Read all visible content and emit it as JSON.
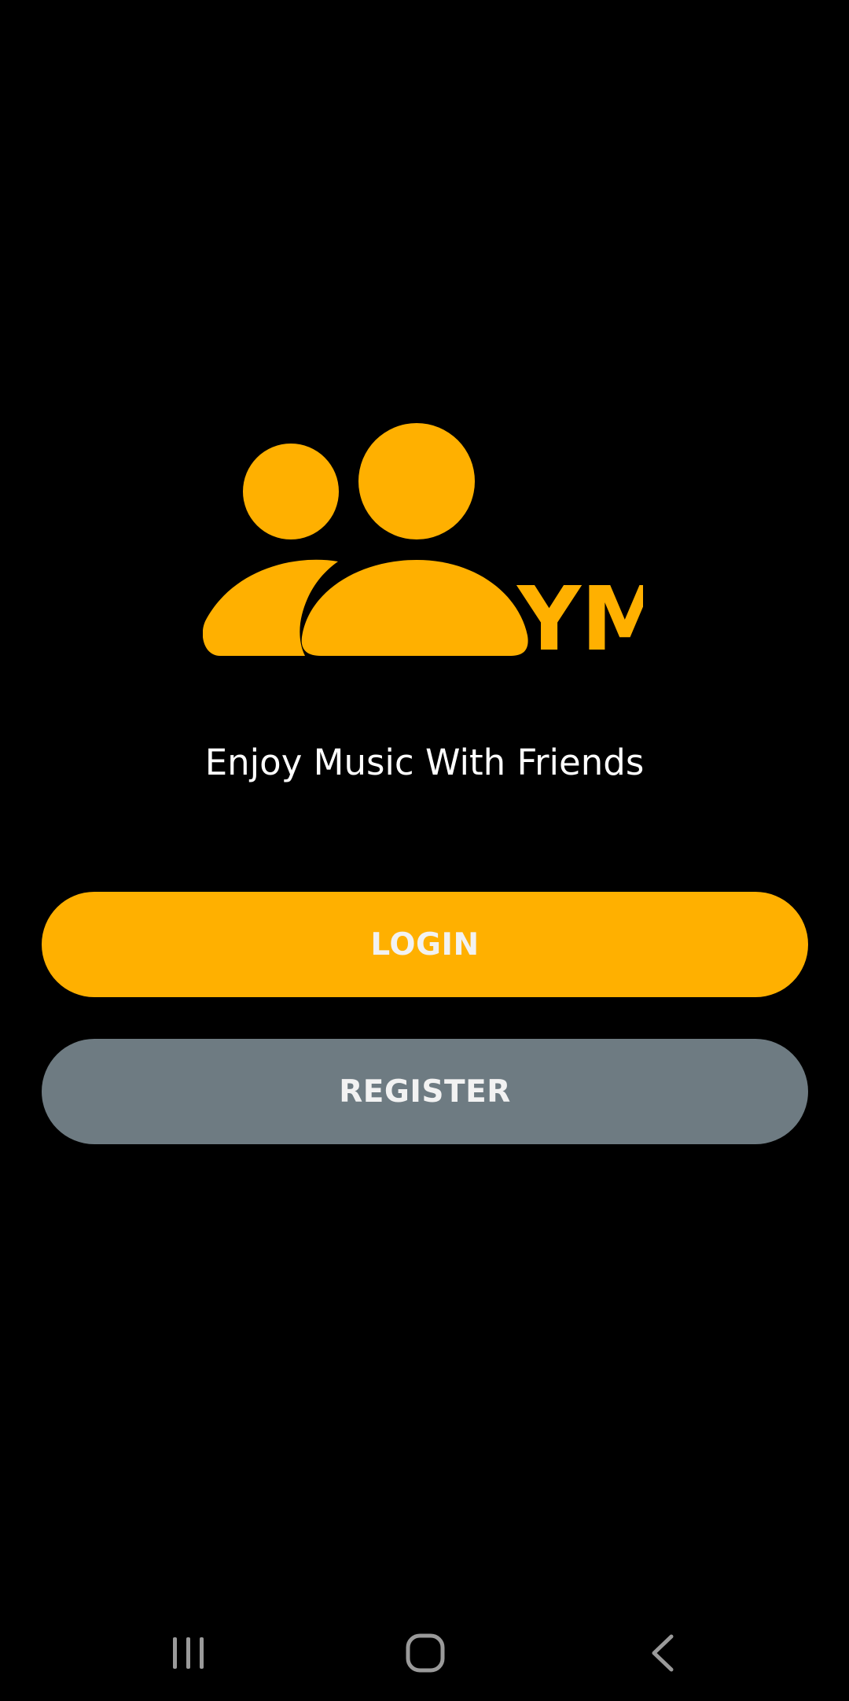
{
  "brand": {
    "logo_text": "YM",
    "logo_icon": "users-icon",
    "accent_color": "#FFB000"
  },
  "tagline": "Enjoy Music With Friends",
  "actions": {
    "login_label": "LOGIN",
    "register_label": "REGISTER",
    "login_color": "#FFB000",
    "register_color": "#6E7B82"
  },
  "system_nav": {
    "recent_icon": "recent-apps-icon",
    "home_icon": "home-icon",
    "back_icon": "back-icon"
  }
}
